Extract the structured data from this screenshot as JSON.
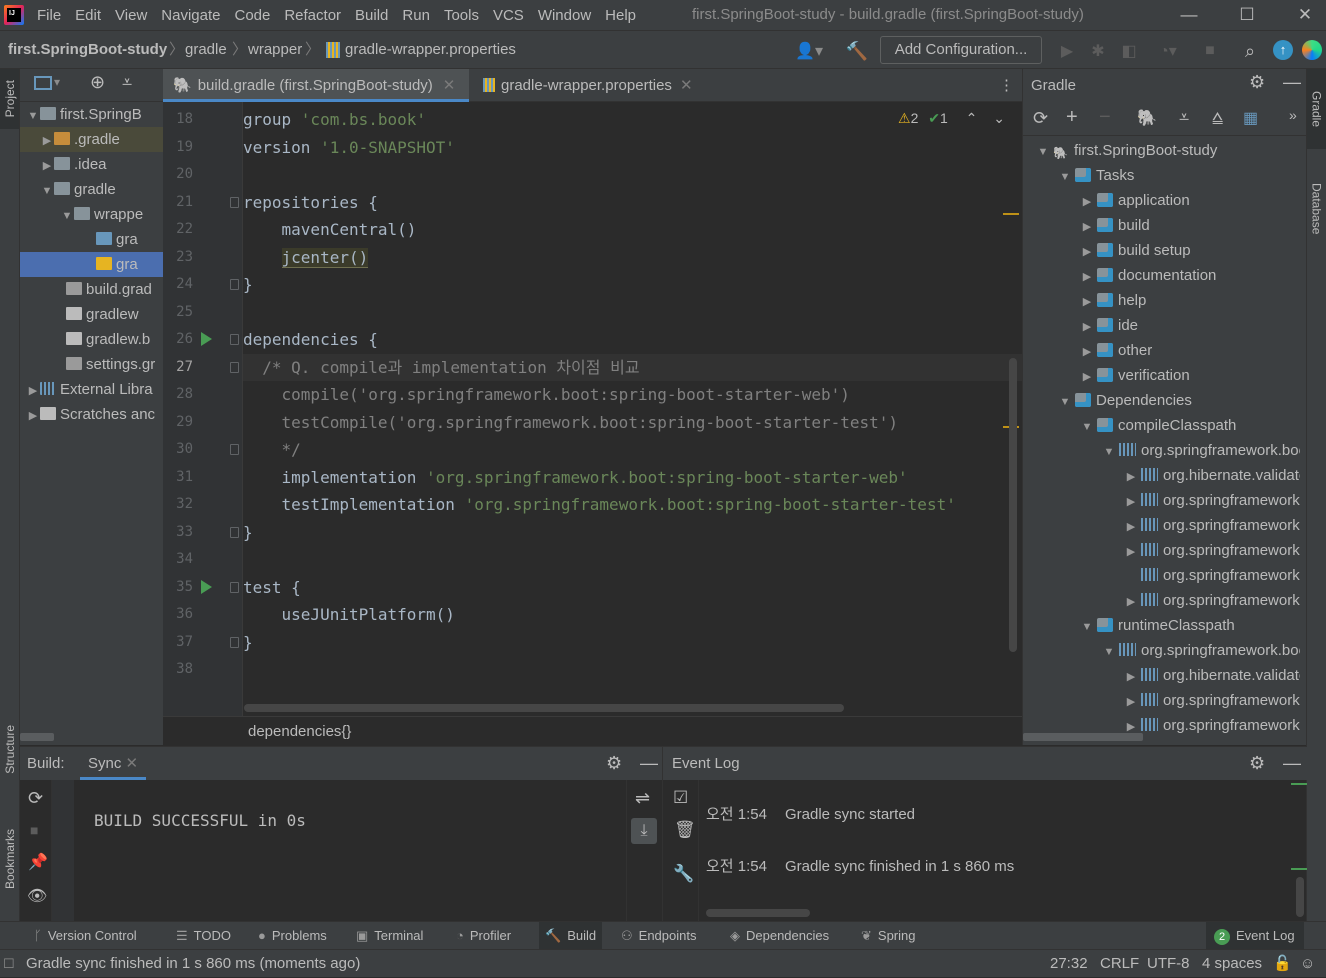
{
  "window": {
    "title": "first.SpringBoot-study - build.gradle (first.SpringBoot-study)",
    "menus": [
      "File",
      "Edit",
      "View",
      "Navigate",
      "Code",
      "Refactor",
      "Build",
      "Run",
      "Tools",
      "VCS",
      "Window",
      "Help"
    ]
  },
  "breadcrumbs": [
    "first.SpringBoot-study",
    "gradle",
    "wrapper",
    "gradle-wrapper.properties"
  ],
  "toolbar": {
    "add_configuration": "Add Configuration..."
  },
  "left_stripe": {
    "project": "Project",
    "structure": "Structure",
    "bookmarks": "Bookmarks"
  },
  "right_stripe": {
    "gradle": "Gradle",
    "database": "Database"
  },
  "project_tree": [
    {
      "label": "first.SpringB",
      "arrow": "down",
      "icon": "folder-icon"
    },
    {
      "label": ".gradle",
      "arrow": "right",
      "icon": "folder-orange-icon"
    },
    {
      "label": ".idea",
      "arrow": "right",
      "icon": "folder-icon"
    },
    {
      "label": "gradle",
      "arrow": "down",
      "icon": "folder-icon"
    },
    {
      "label": "wrappe",
      "arrow": "down",
      "icon": "folder-icon"
    },
    {
      "label": "gra",
      "arrow": "",
      "icon": "jar-icon"
    },
    {
      "label": "gra",
      "arrow": "",
      "icon": "properties-icon"
    },
    {
      "label": "build.grad",
      "arrow": "",
      "icon": "gradle-elephant-icon"
    },
    {
      "label": "gradlew",
      "arrow": "",
      "icon": "script-icon"
    },
    {
      "label": "gradlew.b",
      "arrow": "",
      "icon": "batch-file-icon"
    },
    {
      "label": "settings.gr",
      "arrow": "",
      "icon": "gradle-elephant-icon"
    },
    {
      "label": "External Libra",
      "arrow": "right",
      "icon": "library-icon"
    },
    {
      "label": "Scratches anc",
      "arrow": "right",
      "icon": "scratches-icon"
    }
  ],
  "editor": {
    "tabs": [
      {
        "label": "build.gradle (first.SpringBoot-study)",
        "active": true
      },
      {
        "label": "gradle-wrapper.properties",
        "active": false
      }
    ],
    "inspections": {
      "warnings": "2",
      "ok": "1"
    },
    "line_numbers": [
      "18",
      "19",
      "20",
      "21",
      "22",
      "23",
      "24",
      "25",
      "26",
      "27",
      "28",
      "29",
      "30",
      "31",
      "32",
      "33",
      "34",
      "35",
      "36",
      "37",
      "38"
    ],
    "lines": [
      [
        {
          "t": "group ",
          "c": "kw"
        },
        {
          "t": "'com.bs.book'",
          "c": "str"
        }
      ],
      [
        {
          "t": "version ",
          "c": "kw"
        },
        {
          "t": "'1.0-SNAPSHOT'",
          "c": "str"
        }
      ],
      [],
      [
        {
          "t": "repositories {",
          "c": "kw"
        }
      ],
      [
        {
          "t": "    mavenCentral()",
          "c": "kw"
        }
      ],
      [
        {
          "t": "    ",
          "c": "kw"
        },
        {
          "t": "jcenter()",
          "c": "hl"
        }
      ],
      [
        {
          "t": "}",
          "c": "kw"
        }
      ],
      [],
      [
        {
          "t": "dependencies {",
          "c": "kw"
        }
      ],
      [
        {
          "t": "  /* Q. compile과 implementation 차이점 비교",
          "c": "cmt"
        }
      ],
      [
        {
          "t": "    compile('org.springframework.boot:spring-boot-starter-web')",
          "c": "cmt"
        }
      ],
      [
        {
          "t": "    testCompile('org.springframework.boot:spring-boot-starter-test')",
          "c": "cmt"
        }
      ],
      [
        {
          "t": "    */",
          "c": "cmt"
        }
      ],
      [
        {
          "t": "    implementation ",
          "c": "kw"
        },
        {
          "t": "'org.springframework.boot:spring-boot-starter-web'",
          "c": "str"
        }
      ],
      [
        {
          "t": "    testImplementation ",
          "c": "kw"
        },
        {
          "t": "'org.springframework.boot:spring-boot-starter-test'",
          "c": "str"
        }
      ],
      [
        {
          "t": "}",
          "c": "kw"
        }
      ],
      [],
      [
        {
          "t": "test {",
          "c": "kw"
        }
      ],
      [
        {
          "t": "    useJUnitPlatform()",
          "c": "kw"
        }
      ],
      [
        {
          "t": "}",
          "c": "kw"
        }
      ],
      []
    ],
    "breadcrumb": "dependencies{}"
  },
  "gradle_panel": {
    "title": "Gradle",
    "tree": [
      {
        "label": "first.SpringBoot-study",
        "arrow": "down",
        "level": 0,
        "icon": "gradle-elephant-icon"
      },
      {
        "label": "Tasks",
        "arrow": "down",
        "level": 1,
        "icon": "task-folder-icon"
      },
      {
        "label": "application",
        "arrow": "right",
        "level": 2,
        "icon": "task-folder-icon"
      },
      {
        "label": "build",
        "arrow": "right",
        "level": 2,
        "icon": "task-folder-icon"
      },
      {
        "label": "build setup",
        "arrow": "right",
        "level": 2,
        "icon": "task-folder-icon"
      },
      {
        "label": "documentation",
        "arrow": "right",
        "level": 2,
        "icon": "task-folder-icon"
      },
      {
        "label": "help",
        "arrow": "right",
        "level": 2,
        "icon": "task-folder-icon"
      },
      {
        "label": "ide",
        "arrow": "right",
        "level": 2,
        "icon": "task-folder-icon"
      },
      {
        "label": "other",
        "arrow": "right",
        "level": 2,
        "icon": "task-folder-icon"
      },
      {
        "label": "verification",
        "arrow": "right",
        "level": 2,
        "icon": "task-folder-icon"
      },
      {
        "label": "Dependencies",
        "arrow": "down",
        "level": 1,
        "icon": "dependencies-icon"
      },
      {
        "label": "compileClasspath",
        "arrow": "down",
        "level": 2,
        "icon": "dependencies-icon"
      },
      {
        "label": "org.springframework.boo",
        "arrow": "down",
        "level": 3,
        "icon": "library-icon"
      },
      {
        "label": "org.hibernate.validato",
        "arrow": "right",
        "level": 4,
        "icon": "library-icon"
      },
      {
        "label": "org.springframework",
        "arrow": "right",
        "level": 4,
        "icon": "library-icon"
      },
      {
        "label": "org.springframework",
        "arrow": "right",
        "level": 4,
        "icon": "library-icon"
      },
      {
        "label": "org.springframework",
        "arrow": "right",
        "level": 4,
        "icon": "library-icon"
      },
      {
        "label": "org.springframework",
        "arrow": "",
        "level": 4,
        "icon": "library-icon"
      },
      {
        "label": "org.springframework",
        "arrow": "right",
        "level": 4,
        "icon": "library-icon"
      },
      {
        "label": "runtimeClasspath",
        "arrow": "down",
        "level": 2,
        "icon": "dependencies-icon"
      },
      {
        "label": "org.springframework.boo",
        "arrow": "down",
        "level": 3,
        "icon": "library-icon"
      },
      {
        "label": "org.hibernate.validato",
        "arrow": "right",
        "level": 4,
        "icon": "library-icon"
      },
      {
        "label": "org.springframework",
        "arrow": "right",
        "level": 4,
        "icon": "library-icon"
      },
      {
        "label": "org.springframework",
        "arrow": "right",
        "level": 4,
        "icon": "library-icon"
      }
    ]
  },
  "build_panel": {
    "label": "Build:",
    "tab": "Sync",
    "output": "BUILD SUCCESSFUL in 0s"
  },
  "event_log": {
    "title": "Event Log",
    "entries": [
      {
        "time": "오전 1:54",
        "message": "Gradle sync started"
      },
      {
        "time": "오전 1:54",
        "message": "Gradle sync finished in 1 s 860 ms"
      }
    ]
  },
  "bottom_tools": [
    {
      "label": "Version Control",
      "icon": "branch-icon"
    },
    {
      "label": "TODO",
      "icon": "list-icon"
    },
    {
      "label": "Problems",
      "icon": "info-icon"
    },
    {
      "label": "Terminal",
      "icon": "terminal-icon"
    },
    {
      "label": "Profiler",
      "icon": "profiler-icon"
    },
    {
      "label": "Build",
      "icon": "hammer-icon"
    },
    {
      "label": "Endpoints",
      "icon": "endpoints-icon"
    },
    {
      "label": "Dependencies",
      "icon": "layers-icon"
    },
    {
      "label": "Spring",
      "icon": "spring-icon"
    }
  ],
  "event_log_button": {
    "count": "2",
    "label": "Event Log"
  },
  "status": {
    "message": "Gradle sync finished in 1 s 860 ms (moments ago)",
    "position": "27:32",
    "line_sep": "CRLF",
    "encoding": "UTF-8",
    "indent": "4 spaces"
  },
  "colors": {
    "accent": "#4a6bad",
    "selection": "#4b6eaf",
    "string": "#6a8759",
    "comment": "#808080",
    "warning": "#e6b422",
    "success": "#499c54"
  }
}
